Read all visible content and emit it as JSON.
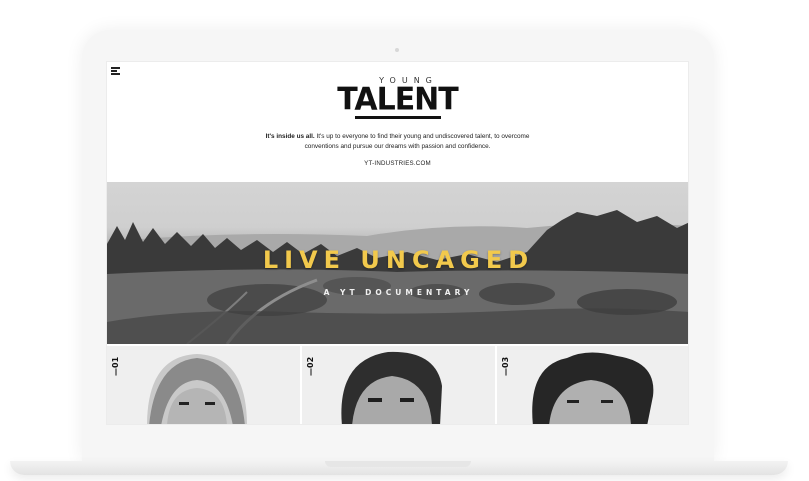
{
  "brand": {
    "logo_small": "YOUNG",
    "logo_big": "TALENT"
  },
  "intro": {
    "lead": "It's inside us all.",
    "line1": " It's up to everyone to find their young and undiscovered talent, to overcome",
    "line2": "conventions and pursue our dreams with passion and confidence.",
    "link": "YT-INDUSTRIES.COM"
  },
  "hero": {
    "title": "LIVE UNCAGED",
    "subtitle": "A YT DOCUMENTARY"
  },
  "cards": [
    {
      "number": "—01"
    },
    {
      "number": "—02"
    },
    {
      "number": "—03"
    }
  ],
  "colors": {
    "accent": "#f2c94c",
    "text": "#111111",
    "card_bg": "#efefef"
  },
  "icons": {
    "menu": "hamburger-menu-icon"
  }
}
